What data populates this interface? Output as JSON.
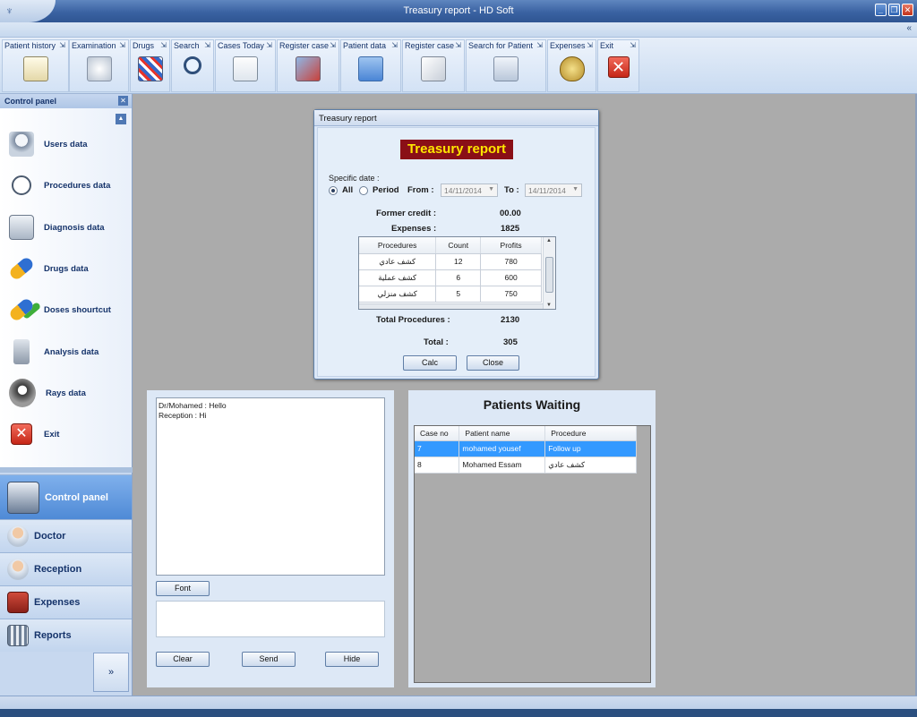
{
  "window": {
    "title": "Treasury report - HD Soft"
  },
  "toolbar": {
    "groups": [
      {
        "label": "Patient history",
        "icon": "clipboard-icon"
      },
      {
        "label": "Examination",
        "icon": "stethoscope-icon"
      },
      {
        "label": "Drugs",
        "icon": "pills-icon"
      },
      {
        "label": "Search",
        "icon": "magnifier-icon"
      },
      {
        "label": "Cases Today",
        "icon": "calendar-icon"
      },
      {
        "label": "Register case",
        "icon": "register-icon"
      },
      {
        "label": "Patient data",
        "icon": "folder-icon"
      },
      {
        "label": "Register case",
        "icon": "pen-icon"
      },
      {
        "label": "Search for Patient",
        "icon": "id-card-icon"
      },
      {
        "label": "Expenses",
        "icon": "money-bag-icon"
      },
      {
        "label": "Exit",
        "icon": "close-icon"
      }
    ]
  },
  "control_panel": {
    "title": "Control panel",
    "items": [
      {
        "label": "Users data",
        "icon": "user-icon"
      },
      {
        "label": "Procedures data",
        "icon": "stethoscope-icon"
      },
      {
        "label": "Diagnosis data",
        "icon": "diagnosis-icon"
      },
      {
        "label": "Drugs data",
        "icon": "capsule-icon"
      },
      {
        "label": "Doses shourtcut",
        "icon": "capsule-arrow-icon"
      },
      {
        "label": "Analysis data",
        "icon": "microscope-icon"
      },
      {
        "label": "Rays data",
        "icon": "xray-icon"
      },
      {
        "label": "Exit",
        "icon": "close-icon"
      }
    ]
  },
  "nav": {
    "items": [
      {
        "label": "Control panel",
        "icon": "control-panel-icon",
        "active": true
      },
      {
        "label": "Doctor",
        "icon": "doctor-icon"
      },
      {
        "label": "Reception",
        "icon": "reception-icon"
      },
      {
        "label": "Expenses",
        "icon": "expenses-icon"
      },
      {
        "label": "Reports",
        "icon": "reports-icon"
      }
    ]
  },
  "treasury_dialog": {
    "window_title": "Treasury report",
    "heading": "Treasury report",
    "specific_date_label": "Specific date :",
    "radio_all": "All",
    "radio_period": "Period",
    "from_label": "From :",
    "from_value": "14/11/2014",
    "to_label": "To :",
    "to_value": "14/11/2014",
    "former_credit_label": "Former credit :",
    "former_credit_value": "00.00",
    "expenses_label": "Expenses :",
    "expenses_value": "1825",
    "grid": {
      "columns": [
        "Procedures",
        "Count",
        "Profits"
      ],
      "rows": [
        [
          "كشف عادي",
          "12",
          "780"
        ],
        [
          "كشف عملية",
          "6",
          "600"
        ],
        [
          "كشف منزلي",
          "5",
          "750"
        ]
      ]
    },
    "total_procedures_label": "Total Procedures :",
    "total_procedures_value": "2130",
    "total_label": "Total :",
    "total_value": "305",
    "calc_button": "Calc",
    "close_button": "Close"
  },
  "chat": {
    "messages": [
      "Dr/Mohamed : Hello",
      "Reception : Hi"
    ],
    "font_button": "Font",
    "clear_button": "Clear",
    "send_button": "Send",
    "hide_button": "Hide"
  },
  "waiting": {
    "title": "Patients Waiting",
    "columns": [
      "Case no",
      "Patient name",
      "Procedure"
    ],
    "rows": [
      [
        "7",
        "mohamed yousef",
        "Follow up"
      ],
      [
        "8",
        "Mohamed Essam",
        "كشف عادي"
      ]
    ]
  },
  "colors": {
    "report_heading_bg": "#8a0f17",
    "report_heading_fg": "#ffe600",
    "selection": "#3399ff"
  }
}
